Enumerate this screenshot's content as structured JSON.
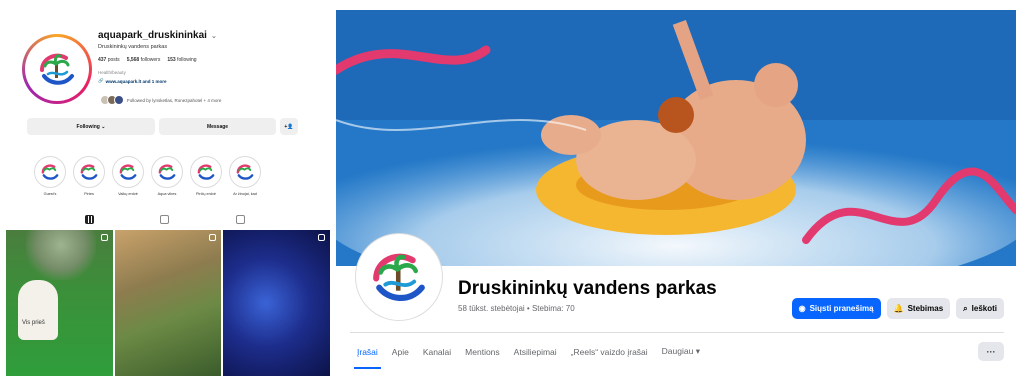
{
  "instagram": {
    "username": "aquapark_druskininkai",
    "full_name": "Druskininkų vandens parkas",
    "stats": {
      "posts": "437",
      "posts_label": "posts",
      "followers": "5,568",
      "followers_label": "followers",
      "following": "153",
      "following_label": "following"
    },
    "category": "Health/beauty",
    "link": "www.aquapark.lt and 1 more",
    "followed_by": "Followed by lynsketlas, Ronezpahotel + 4 more",
    "buttons": {
      "following": "Following",
      "message": "Message",
      "add": "+ዶ"
    },
    "stories": [
      {
        "label": "Guest's"
      },
      {
        "label": "Pirtes"
      },
      {
        "label": "Vaikų erdvė"
      },
      {
        "label": "Aqua vibes"
      },
      {
        "label": "Pirčių erdvė"
      },
      {
        "label": "Ar žinojai, kad"
      }
    ],
    "grid_text": "Vis prieš"
  },
  "facebook": {
    "page_name": "Druskininkų vandens parkas",
    "subtitle": "58 tūkst. stebėtojai • Stebima: 70",
    "actions": {
      "message": "Siųsti pranešimą",
      "follow": "Stebimas",
      "search": "Ieškoti"
    },
    "tabs": [
      "Įrašai",
      "Apie",
      "Kanalai",
      "Mentions",
      "Atsiliepimai",
      "„Reels“ vaizdo įrašai",
      "Daugiau ▾"
    ],
    "more": "···"
  },
  "colors": {
    "fb_blue": "#0866ff",
    "brand_pink": "#e2396f",
    "brand_blue": "#1e56c8",
    "palm_green": "#2aa84a"
  }
}
